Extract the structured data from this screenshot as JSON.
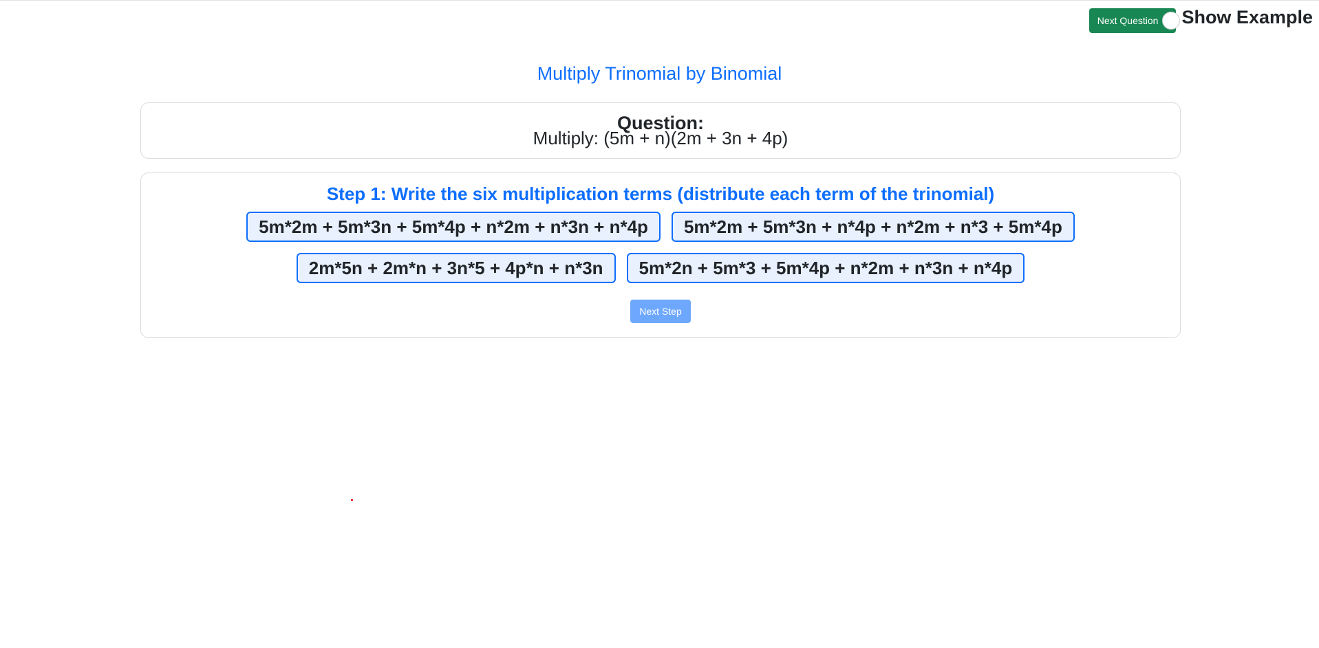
{
  "top_controls": {
    "next_question_label": "Next Question",
    "show_example_label": "Show Example"
  },
  "title": "Multiply Trinomial by Binomial",
  "question": {
    "heading": "Question:",
    "text": "Multiply: (5m + n)(2m + 3n + 4p)"
  },
  "step": {
    "heading": "Step 1: Write the six multiplication terms (distribute each term of the trinomial)",
    "options": [
      "5m*2m + 5m*3n + 5m*4p + n*2m + n*3n + n*4p",
      "5m*2m + 5m*3n + n*4p + n*2m + n*3 + 5m*4p",
      "2m*5n + 2m*n + 3n*5 + 4p*n + n*3n",
      "5m*2n + 5m*3 + 5m*4p + n*2m + n*3n + n*4p"
    ],
    "next_step_label": "Next Step"
  },
  "colors": {
    "primary": "#0d6efd",
    "success": "#198754",
    "option_bg": "#e8f1fd",
    "next_step_bg": "#6ea8fe"
  }
}
